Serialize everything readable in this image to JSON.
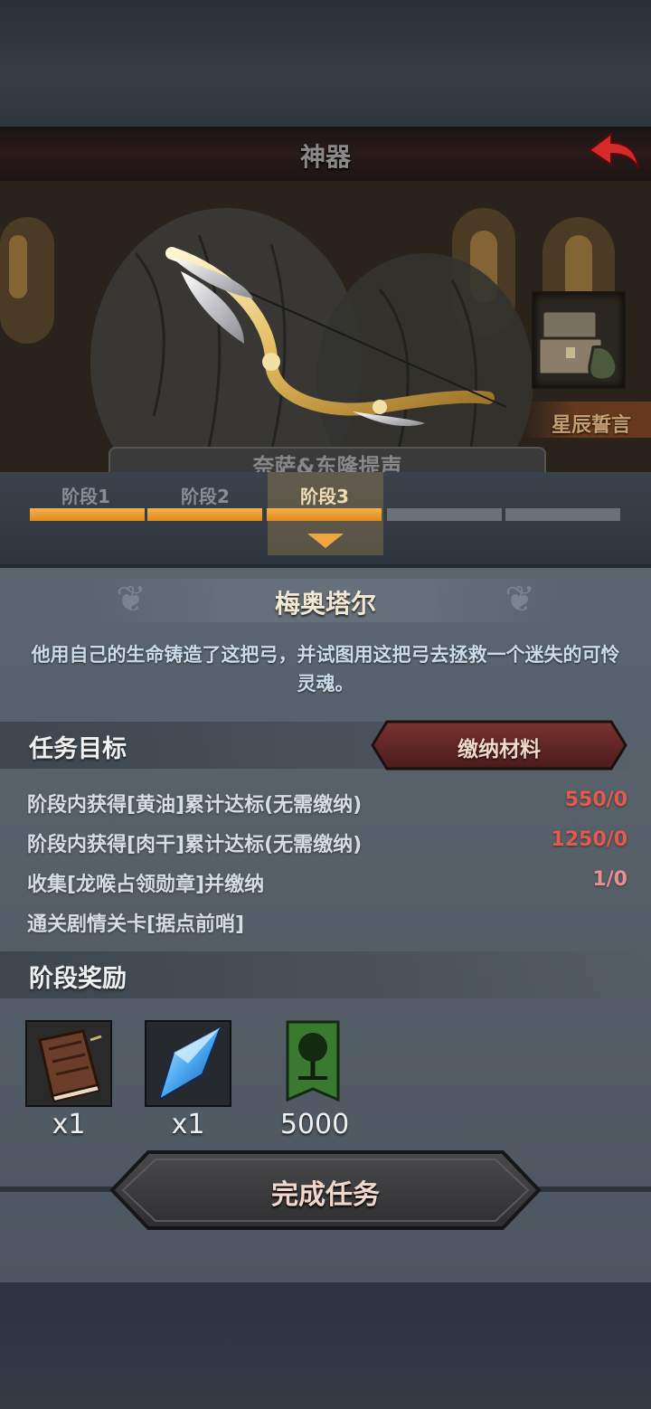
{
  "header": {
    "title": "神器"
  },
  "artifact_art": {
    "name_badge": "星辰誓言",
    "bottom_label": "奈萨&东隆提声"
  },
  "stages": {
    "tabs": [
      {
        "label": "阶段1"
      },
      {
        "label": "阶段2"
      },
      {
        "label": "阶段3"
      }
    ],
    "active_index": 2,
    "segments_total": 5,
    "segments_done": 3
  },
  "artifact": {
    "name": "梅奥塔尔",
    "description": "他用自己的生命铸造了这把弓，并试图用这把弓去拯救一个迷失的可怜灵魂。"
  },
  "tasks": {
    "title": "任务目标",
    "submit_label": "缴纳材料",
    "items": [
      {
        "text": "阶段内获得[黄油]累计达标(无需缴纳)",
        "progress": "550/0"
      },
      {
        "text": "阶段内获得[肉干]累计达标(无需缴纳)",
        "progress": "1250/0"
      },
      {
        "text": "收集[龙喉占领勋章]并缴纳",
        "progress": "1/0"
      },
      {
        "text": "通关剧情关卡[据点前哨]",
        "progress": ""
      }
    ]
  },
  "rewards": {
    "title": "阶段奖励",
    "items": [
      {
        "icon": "book-icon",
        "count": "x1"
      },
      {
        "icon": "crystal-icon",
        "count": "x1"
      },
      {
        "icon": "tree-banner-icon",
        "count": "5000"
      }
    ]
  },
  "complete_button": {
    "label": "完成任务"
  },
  "colors": {
    "accent_orange": "#f0a640",
    "progress_red": "#e45a4c",
    "header_dark_red": "#2a1a1a"
  }
}
